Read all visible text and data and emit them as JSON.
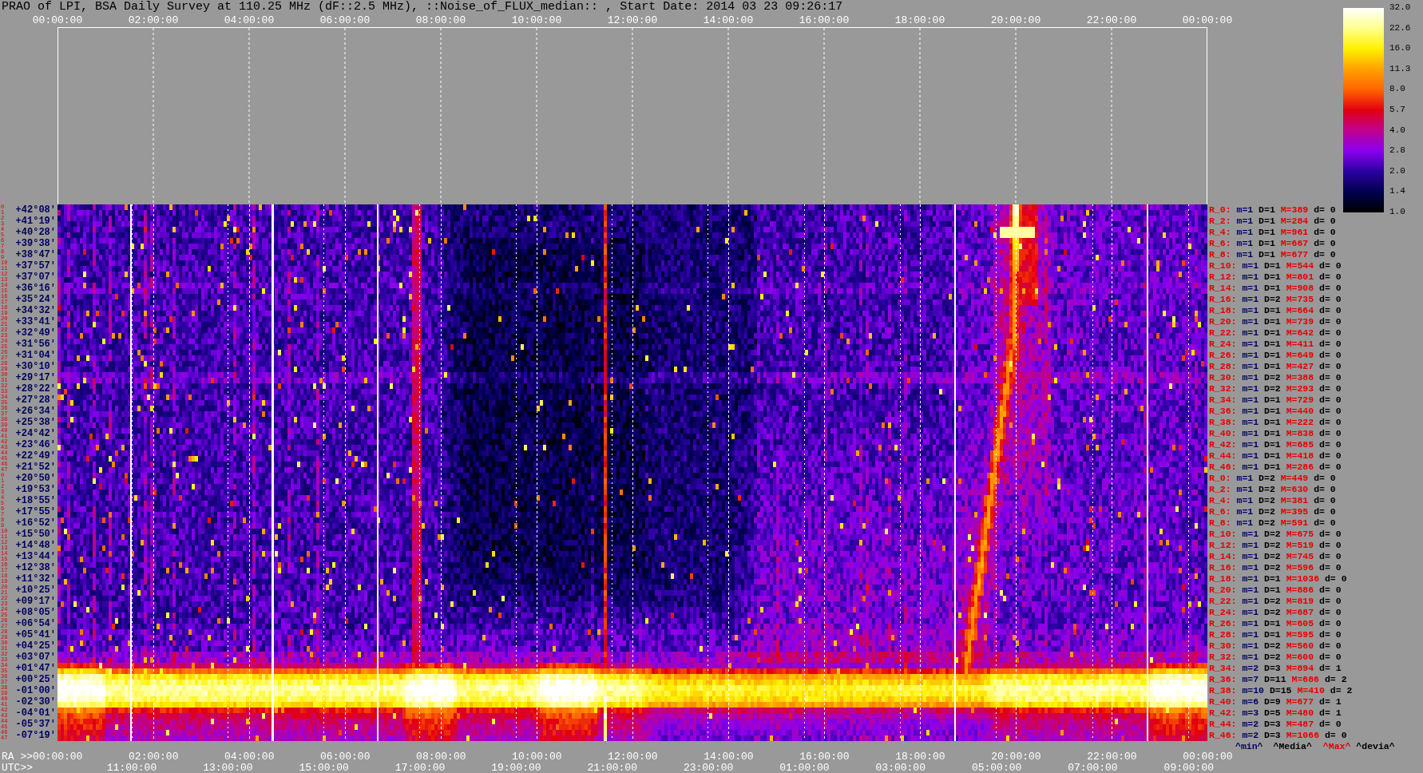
{
  "title": "PRAO of LPI, BSA Daily Survey at 110.25 MHz (dF::2.5 MHz), ::Noise_of_FLUX_median:: , Start Date: 2014 03 23 09:26:17",
  "top_axis": {
    "ticks": [
      "00:00:00",
      "02:00:00",
      "04:00:00",
      "06:00:00",
      "08:00:00",
      "10:00:00",
      "12:00:00",
      "14:00:00",
      "16:00:00",
      "18:00:00",
      "20:00:00",
      "22:00:00",
      "00:00:00"
    ]
  },
  "color_scale": {
    "ticks": [
      "32.0",
      "22.6",
      "16.0",
      "11.3",
      "8.0",
      "5.7",
      "4.0",
      "2.8",
      "2.0",
      "1.4",
      "1.0"
    ]
  },
  "rows": [
    {
      "beams": [
        "0",
        "1"
      ],
      "declination": "+42°08'",
      "stats": {
        "label": "R_0:",
        "min": "m=1",
        "median": "D=1",
        "max": "M=389",
        "deviation": "d= 0"
      }
    },
    {
      "beams": [
        "2",
        "3"
      ],
      "declination": "+41°19'",
      "stats": {
        "label": "R_2:",
        "min": "m=1",
        "median": "D=1",
        "max": "M=284",
        "deviation": "d= 0"
      }
    },
    {
      "beams": [
        "4",
        "5"
      ],
      "declination": "+40°28'",
      "stats": {
        "label": "R_4:",
        "min": "m=1",
        "median": "D=1",
        "max": "M=961",
        "deviation": "d= 0"
      }
    },
    {
      "beams": [
        "6",
        "7"
      ],
      "declination": "+39°38'",
      "stats": {
        "label": "R_6:",
        "min": "m=1",
        "median": "D=1",
        "max": "M=667",
        "deviation": "d= 0"
      }
    },
    {
      "beams": [
        "8",
        "9"
      ],
      "declination": "+38°47'",
      "stats": {
        "label": "R_8:",
        "min": "m=1",
        "median": "D=1",
        "max": "M=677",
        "deviation": "d= 0"
      }
    },
    {
      "beams": [
        "10",
        "11"
      ],
      "declination": "+37°57'",
      "stats": {
        "label": "R_10:",
        "min": "m=1",
        "median": "D=1",
        "max": "M=544",
        "deviation": "d= 0"
      }
    },
    {
      "beams": [
        "12",
        "13"
      ],
      "declination": "+37°07'",
      "stats": {
        "label": "R_12:",
        "min": "m=1",
        "median": "D=1",
        "max": "M=801",
        "deviation": "d= 0"
      }
    },
    {
      "beams": [
        "14",
        "15"
      ],
      "declination": "+36°16'",
      "stats": {
        "label": "R_14:",
        "min": "m=1",
        "median": "D=1",
        "max": "M=908",
        "deviation": "d= 0"
      }
    },
    {
      "beams": [
        "16",
        "17"
      ],
      "declination": "+35°24'",
      "stats": {
        "label": "R_16:",
        "min": "m=1",
        "median": "D=2",
        "max": "M=735",
        "deviation": "d= 0"
      }
    },
    {
      "beams": [
        "18",
        "19"
      ],
      "declination": "+34°32'",
      "stats": {
        "label": "R_18:",
        "min": "m=1",
        "median": "D=1",
        "max": "M=664",
        "deviation": "d= 0"
      }
    },
    {
      "beams": [
        "20",
        "21"
      ],
      "declination": "+33°41'",
      "stats": {
        "label": "R_20:",
        "min": "m=1",
        "median": "D=1",
        "max": "M=739",
        "deviation": "d= 0"
      }
    },
    {
      "beams": [
        "22",
        "23"
      ],
      "declination": "+32°49'",
      "stats": {
        "label": "R_22:",
        "min": "m=1",
        "median": "D=1",
        "max": "M=642",
        "deviation": "d= 0"
      }
    },
    {
      "beams": [
        "24",
        "25"
      ],
      "declination": "+31°56'",
      "stats": {
        "label": "R_24:",
        "min": "m=1",
        "median": "D=1",
        "max": "M=411",
        "deviation": "d= 0"
      }
    },
    {
      "beams": [
        "26",
        "27"
      ],
      "declination": "+31°04'",
      "stats": {
        "label": "R_26:",
        "min": "m=1",
        "median": "D=1",
        "max": "M=649",
        "deviation": "d= 0"
      }
    },
    {
      "beams": [
        "28",
        "29"
      ],
      "declination": "+30°10'",
      "stats": {
        "label": "R_28:",
        "min": "m=1",
        "median": "D=1",
        "max": "M=427",
        "deviation": "d= 0"
      }
    },
    {
      "beams": [
        "30",
        "31"
      ],
      "declination": "+29°17'",
      "stats": {
        "label": "R_30:",
        "min": "m=1",
        "median": "D=2",
        "max": "M=388",
        "deviation": "d= 0"
      }
    },
    {
      "beams": [
        "32",
        "33"
      ],
      "declination": "+28°22'",
      "stats": {
        "label": "R_32:",
        "min": "m=1",
        "median": "D=2",
        "max": "M=293",
        "deviation": "d= 0"
      }
    },
    {
      "beams": [
        "34",
        "35"
      ],
      "declination": "+27°28'",
      "stats": {
        "label": "R_34:",
        "min": "m=1",
        "median": "D=1",
        "max": "M=729",
        "deviation": "d= 0"
      }
    },
    {
      "beams": [
        "36",
        "37"
      ],
      "declination": "+26°34'",
      "stats": {
        "label": "R_36:",
        "min": "m=1",
        "median": "D=1",
        "max": "M=440",
        "deviation": "d= 0"
      }
    },
    {
      "beams": [
        "38",
        "39"
      ],
      "declination": "+25°38'",
      "stats": {
        "label": "R_38:",
        "min": "m=1",
        "median": "D=1",
        "max": "M=222",
        "deviation": "d= 0"
      }
    },
    {
      "beams": [
        "40",
        "41"
      ],
      "declination": "+24°42'",
      "stats": {
        "label": "R_40:",
        "min": "m=1",
        "median": "D=1",
        "max": "M=838",
        "deviation": "d= 0"
      }
    },
    {
      "beams": [
        "42",
        "43"
      ],
      "declination": "+23°46'",
      "stats": {
        "label": "R_42:",
        "min": "m=1",
        "median": "D=1",
        "max": "M=685",
        "deviation": "d= 0"
      }
    },
    {
      "beams": [
        "44",
        "45"
      ],
      "declination": "+22°49'",
      "stats": {
        "label": "R_44:",
        "min": "m=1",
        "median": "D=1",
        "max": "M=418",
        "deviation": "d= 0"
      }
    },
    {
      "beams": [
        "46",
        "47"
      ],
      "declination": "+21°52'",
      "stats": {
        "label": "R_46:",
        "min": "m=1",
        "median": "D=1",
        "max": "M=286",
        "deviation": "d= 0"
      }
    },
    {
      "beams": [
        "0",
        "1"
      ],
      "declination": "+20°50'",
      "stats": {
        "label": "R_0:",
        "min": "m=1",
        "median": "D=2",
        "max": "M=449",
        "deviation": "d= 0"
      }
    },
    {
      "beams": [
        "2",
        "3"
      ],
      "declination": "+19°53'",
      "stats": {
        "label": "R_2:",
        "min": "m=1",
        "median": "D=2",
        "max": "M=630",
        "deviation": "d= 0"
      }
    },
    {
      "beams": [
        "4",
        "5"
      ],
      "declination": "+18°55'",
      "stats": {
        "label": "R_4:",
        "min": "m=1",
        "median": "D=2",
        "max": "M=381",
        "deviation": "d= 0"
      }
    },
    {
      "beams": [
        "6",
        "7"
      ],
      "declination": "+17°55'",
      "stats": {
        "label": "R_6:",
        "min": "m=1",
        "median": "D=2",
        "max": "M=395",
        "deviation": "d= 0"
      }
    },
    {
      "beams": [
        "8",
        "9"
      ],
      "declination": "+16°52'",
      "stats": {
        "label": "R_8:",
        "min": "m=1",
        "median": "D=2",
        "max": "M=591",
        "deviation": "d= 0"
      }
    },
    {
      "beams": [
        "10",
        "11"
      ],
      "declination": "+15°50'",
      "stats": {
        "label": "R_10:",
        "min": "m=1",
        "median": "D=2",
        "max": "M=675",
        "deviation": "d= 0"
      }
    },
    {
      "beams": [
        "12",
        "13"
      ],
      "declination": "+14°48'",
      "stats": {
        "label": "R_12:",
        "min": "m=1",
        "median": "D=2",
        "max": "M=519",
        "deviation": "d= 0"
      }
    },
    {
      "beams": [
        "14",
        "15"
      ],
      "declination": "+13°44'",
      "stats": {
        "label": "R_14:",
        "min": "m=1",
        "median": "D=2",
        "max": "M=745",
        "deviation": "d= 0"
      }
    },
    {
      "beams": [
        "16",
        "17"
      ],
      "declination": "+12°38'",
      "stats": {
        "label": "R_16:",
        "min": "m=1",
        "median": "D=2",
        "max": "M=596",
        "deviation": "d= 0"
      }
    },
    {
      "beams": [
        "18",
        "19"
      ],
      "declination": "+11°32'",
      "stats": {
        "label": "R_18:",
        "min": "m=1",
        "median": "D=1",
        "max": "M=1036",
        "deviation": "d= 0"
      }
    },
    {
      "beams": [
        "20",
        "21"
      ],
      "declination": "+10°25'",
      "stats": {
        "label": "R_20:",
        "min": "m=1",
        "median": "D=1",
        "max": "M=886",
        "deviation": "d= 0"
      }
    },
    {
      "beams": [
        "22",
        "23"
      ],
      "declination": "+09°17'",
      "stats": {
        "label": "R_22:",
        "min": "m=1",
        "median": "D=2",
        "max": "M=819",
        "deviation": "d= 0"
      }
    },
    {
      "beams": [
        "24",
        "25"
      ],
      "declination": "+08°05'",
      "stats": {
        "label": "R_24:",
        "min": "m=1",
        "median": "D=2",
        "max": "M=687",
        "deviation": "d= 0"
      }
    },
    {
      "beams": [
        "26",
        "27"
      ],
      "declination": "+06°54'",
      "stats": {
        "label": "R_26:",
        "min": "m=1",
        "median": "D=1",
        "max": "M=605",
        "deviation": "d= 0"
      }
    },
    {
      "beams": [
        "28",
        "29"
      ],
      "declination": "+05°41'",
      "stats": {
        "label": "R_28:",
        "min": "m=1",
        "median": "D=1",
        "max": "M=595",
        "deviation": "d= 0"
      }
    },
    {
      "beams": [
        "30",
        "31"
      ],
      "declination": "+04°25'",
      "stats": {
        "label": "R_30:",
        "min": "m=1",
        "median": "D=2",
        "max": "M=560",
        "deviation": "d= 0"
      }
    },
    {
      "beams": [
        "32",
        "33"
      ],
      "declination": "+03°07'",
      "stats": {
        "label": "R_32:",
        "min": "m=1",
        "median": "D=2",
        "max": "M=600",
        "deviation": "d= 0"
      }
    },
    {
      "beams": [
        "34",
        "35"
      ],
      "declination": "+01°47'",
      "stats": {
        "label": "R_34:",
        "min": "m=2",
        "median": "D=3",
        "max": "M=894",
        "deviation": "d= 1"
      }
    },
    {
      "beams": [
        "36",
        "37"
      ],
      "declination": "+00°25'",
      "stats": {
        "label": "R_36:",
        "min": "m=7",
        "median": "D=11",
        "max": "M=686",
        "deviation": "d= 2"
      }
    },
    {
      "beams": [
        "38",
        "39"
      ],
      "declination": "-01°00'",
      "stats": {
        "label": "R_38:",
        "min": "m=10",
        "median": "D=15",
        "max": "M=410",
        "deviation": "d= 2"
      }
    },
    {
      "beams": [
        "40",
        "41"
      ],
      "declination": "-02°30'",
      "stats": {
        "label": "R_40:",
        "min": "m=6",
        "median": "D=9",
        "max": "M=677",
        "deviation": "d= 1"
      }
    },
    {
      "beams": [
        "42",
        "43"
      ],
      "declination": "-04°01'",
      "stats": {
        "label": "R_42:",
        "min": "m=3",
        "median": "D=5",
        "max": "M=480",
        "deviation": "d= 1"
      }
    },
    {
      "beams": [
        "44",
        "45"
      ],
      "declination": "-05°37'",
      "stats": {
        "label": "R_44:",
        "min": "m=2",
        "median": "D=3",
        "max": "M=487",
        "deviation": "d= 0"
      }
    },
    {
      "beams": [
        "46",
        "47"
      ],
      "declination": "-07°19'",
      "stats": {
        "label": "R_46:",
        "min": "m=2",
        "median": "D=3",
        "max": "M=1066",
        "deviation": "d= 0"
      }
    }
  ],
  "stats_legend": {
    "min": "^min^",
    "median": "^Media^",
    "max": "^Max^",
    "deviation": "^devia^"
  },
  "ra_axis": {
    "label": "RA >>",
    "ticks": [
      "00:00:00",
      "02:00:00",
      "04:00:00",
      "06:00:00",
      "08:00:00",
      "10:00:00",
      "12:00:00",
      "14:00:00",
      "16:00:00",
      "18:00:00",
      "20:00:00",
      "22:00:00",
      "00:00:00"
    ]
  },
  "utc_axis": {
    "label": "UTC>>",
    "ticks": [
      "11:00:00",
      "13:00:00",
      "15:00:00",
      "17:00:00",
      "19:00:00",
      "21:00:00",
      "23:00:00",
      "01:00:00",
      "03:00:00",
      "05:00:00",
      "07:00:00",
      "09:00:00"
    ]
  }
}
